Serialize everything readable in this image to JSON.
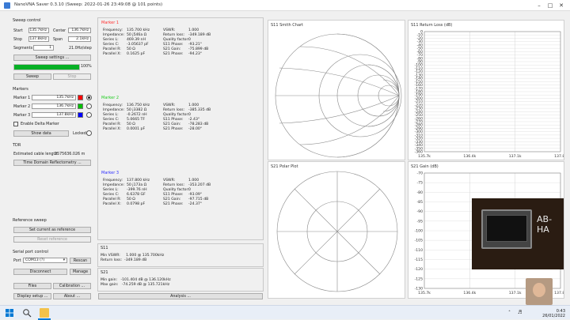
{
  "window": {
    "title": "NanoVNA Saver 0.3.10 (Sweep: 2022-01-26 23:49:08 @ 101 points)"
  },
  "sweep_control": {
    "title": "Sweep control",
    "start_label": "Start",
    "start_value": "135.7kHz",
    "center_label": "Center",
    "center_value": "136.7kHz",
    "stop_label": "Stop",
    "stop_value": "137.8kHz",
    "span_label": "Span",
    "span_value": "2.1kHz",
    "segments_label": "Segments",
    "segments_value": "1",
    "step_value": "21.0Hz/step",
    "settings_button": "Sweep settings ...",
    "progress_percent": 100,
    "progress_text": "100%",
    "sweep_button": "Sweep",
    "stop_button": "Stop"
  },
  "markers": {
    "title": "Markers",
    "items": [
      {
        "label": "Marker 1",
        "value": "135.7kHz",
        "color": "#ff0000"
      },
      {
        "label": "Marker 2",
        "value": "136.7kHz",
        "color": "#00c000"
      },
      {
        "label": "Marker 3",
        "value": "137.8kHz",
        "color": "#0000ff"
      }
    ],
    "delta_label": "Enable Delta Marker",
    "show_data_button": "Show data",
    "locked_label": "Locked"
  },
  "tdr": {
    "title": "TDR",
    "cable_label": "Estimated cable length:",
    "cable_value": "2575636.026 m",
    "tdr_button": "Time Domain Reflectometry ..."
  },
  "reference": {
    "title": "Reference sweep",
    "set_button": "Set current as reference",
    "reset_button": "Reset reference"
  },
  "serial": {
    "title": "Serial port control",
    "port_label": "Port",
    "port_value": "COM13 (?)",
    "rescan_button": "Rescan",
    "disconnect_button": "Disconnect",
    "manage_button": "Manage"
  },
  "bottom_buttons": {
    "files": "Files",
    "calibration": "Calibration ...",
    "display": "Display setup ...",
    "about": "About ..."
  },
  "marker_panels": [
    {
      "title": "Marker 1",
      "color": "#ff3030",
      "left_keys": [
        "Frequency:",
        "Impedance:",
        "Series L:",
        "Series C:",
        "Parallel R:",
        "Parallel X:"
      ],
      "left_vals": [
        "135.700 kHz",
        "50 j546a Ω",
        "469.39 nH",
        "-3.05637 pF",
        "50 Ω",
        "0.1625 pF"
      ],
      "right_keys": [
        "VSWR:",
        "Return loss:",
        "Quality factor:",
        "S11 Phase:",
        "S21 Gain:",
        "S21 Phase:"
      ],
      "right_vals": [
        "1.000",
        "-349.189 dB",
        "0",
        "-93.21°",
        "-75.899 dB",
        "-94.23°"
      ]
    },
    {
      "title": "Marker 2",
      "color": "#22cc22",
      "left_keys": [
        "Frequency:",
        "Impedance:",
        "Series L:",
        "Series C:",
        "Parallel R:",
        "Parallel X:"
      ],
      "left_vals": [
        "136.750 kHz",
        "50 j3382 Ω",
        "-0.2672 nH",
        "5.0665 TF",
        "50 Ω",
        "0.0001 pF"
      ],
      "right_keys": [
        "VSWR:",
        "Return loss:",
        "Quality factor:",
        "S11 Phase:",
        "S21 Gain:",
        "S21 Phase:"
      ],
      "right_vals": [
        "1.000",
        "-385.335 dB",
        "0",
        "-2.43°",
        "-78.283 dB",
        "-28.00°"
      ]
    },
    {
      "title": "Marker 3",
      "color": "#3030ff",
      "left_keys": [
        "Frequency:",
        "Impedance:",
        "Series L:",
        "Series C:",
        "Parallel R:",
        "Parallel X:"
      ],
      "left_vals": [
        "137.800 kHz",
        "50 j173a Ω",
        "-399.76 nH",
        "6.6378 GF",
        "50 Ω",
        "0.0798 pF"
      ],
      "right_keys": [
        "VSWR:",
        "Return loss:",
        "Quality factor:",
        "S11 Phase:",
        "S21 Gain:",
        "S21 Phase:"
      ],
      "right_vals": [
        "1.000",
        "-353.207 dB",
        "0",
        "-93.09°",
        "-97.715 dB",
        "-24.37°"
      ]
    }
  ],
  "s11_summary": {
    "title": "S11",
    "lines": [
      "Min VSWR:     1.000 @ 135.700kHz",
      "Return loss:  -349.189 dB"
    ]
  },
  "s21_summary": {
    "title": "S21",
    "lines": [
      "Min gain:   -101.404 dB @ 136.120kHz",
      "Max gain:   -74.259 dB @ 135.721kHz"
    ]
  },
  "analysis_button": "Analysis ...",
  "charts": {
    "smith_title": "S11 Smith Chart",
    "polar_title": "S21 Polar Plot",
    "return_loss_title": "S11 Return Loss (dB)",
    "gain_title": "S21 Gain (dB)",
    "rl_yticks": [
      "0",
      "-10",
      "-20",
      "-30",
      "-40",
      "-50",
      "-60",
      "-70",
      "-80",
      "-90",
      "-100",
      "-110",
      "-120",
      "-130",
      "-140",
      "-150",
      "-160",
      "-170",
      "-180",
      "-190",
      "-200",
      "-210",
      "-220",
      "-230",
      "-240",
      "-250",
      "-260",
      "-270",
      "-280",
      "-290",
      "-300",
      "-310",
      "-320",
      "-330",
      "-340",
      "-350",
      "-360"
    ],
    "rl_xticks": [
      "135.7k",
      "136.4k",
      "137.1k",
      "137.8k"
    ],
    "gain_yticks": [
      "-70",
      "-75",
      "-80",
      "-85",
      "-90",
      "-95",
      "-100",
      "-105",
      "-110",
      "-115",
      "-120",
      "-125",
      "-130"
    ],
    "gain_xticks": [
      "135.7k",
      "136.4k",
      "137.1k",
      "137.8k"
    ],
    "webcam_text": "AB-HA"
  },
  "taskbar": {
    "time": "0:43",
    "date": "26/01/2022"
  }
}
